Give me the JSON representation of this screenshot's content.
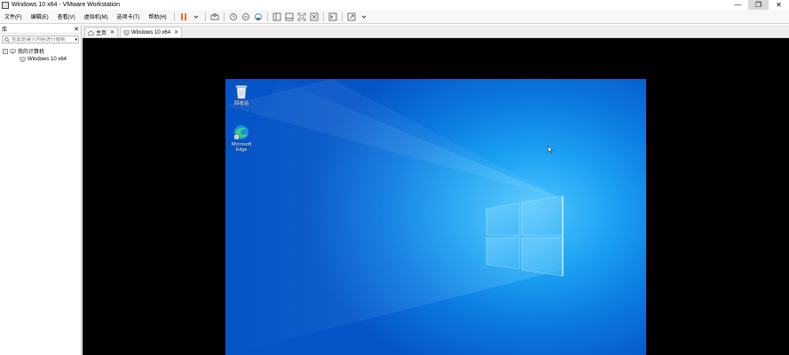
{
  "window": {
    "title": "Windows 10 x64 - VMware Workstation",
    "minimize_glyph": "—",
    "restore_glyph": "❐",
    "close_glyph": "✕"
  },
  "menu": {
    "items": [
      "文件(F)",
      "编辑(E)",
      "查看(V)",
      "虚拟机(M)",
      "选项卡(T)",
      "帮助(H)"
    ]
  },
  "library": {
    "title": "库",
    "close_glyph": "✕",
    "search_placeholder": "在此处键入内容进行搜索",
    "dropdown_glyph": "▾",
    "tree": {
      "root_toggle": "−",
      "root_label": "我的计算机",
      "vm_label": "Windows 10 x64"
    }
  },
  "tabs": [
    {
      "label": "主页",
      "close": "✕",
      "active": false
    },
    {
      "label": "Windows 10 x64",
      "close": "✕",
      "active": true
    }
  ],
  "desktop": {
    "icons": [
      {
        "label": "回收站"
      },
      {
        "label": "Microsoft Edge"
      }
    ]
  },
  "colors": {
    "pause_accent": "#e8731a",
    "desktop_blue": "#0b78df",
    "console_background": "#000000"
  }
}
